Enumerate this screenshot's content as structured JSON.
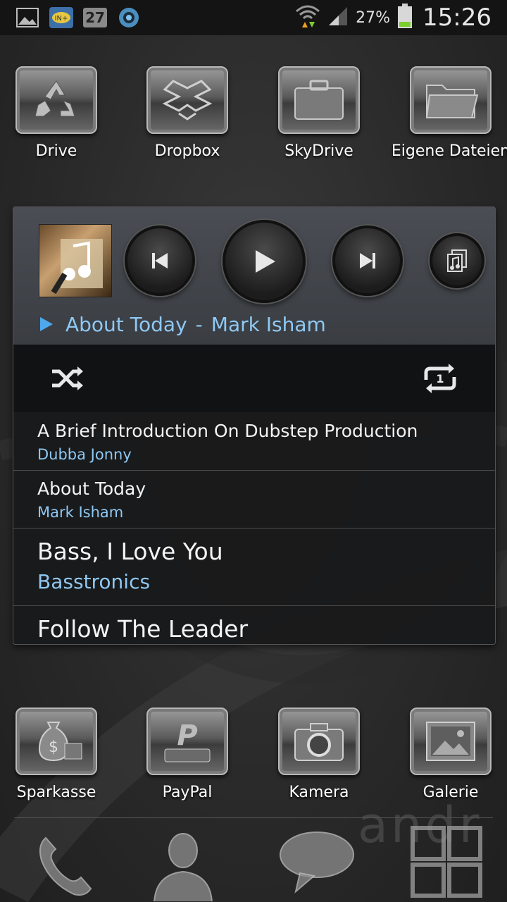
{
  "status_bar": {
    "calendar_day": "27",
    "battery_percent": "27%",
    "time": "15:26",
    "icons": [
      "picture-icon",
      "rss-feed-icon",
      "calendar-icon",
      "camera-eye-icon",
      "wifi-icon",
      "signal-icon",
      "battery-icon"
    ]
  },
  "apps_top": [
    {
      "label": "Drive",
      "icon": "recycle-icon"
    },
    {
      "label": "Dropbox",
      "icon": "dropbox-icon"
    },
    {
      "label": "SkyDrive",
      "icon": "briefcase-icon"
    },
    {
      "label": "Eigene Dateien",
      "icon": "folder-icon"
    }
  ],
  "music_widget": {
    "now_playing_title": "About Today",
    "now_playing_separator": "-",
    "now_playing_artist": "Mark Isham",
    "controls": [
      "previous-icon",
      "play-icon",
      "next-icon",
      "playlist-icon"
    ],
    "modes": [
      "shuffle-icon",
      "repeat-one-icon"
    ],
    "tracks": [
      {
        "title": "A Brief Introduction On Dubstep Production",
        "artist": "Dubba Jonny"
      },
      {
        "title": "About Today",
        "artist": "Mark Isham"
      },
      {
        "title": "Bass, I Love You",
        "artist": "Basstronics"
      },
      {
        "title": "Follow The Leader",
        "artist": ""
      }
    ]
  },
  "apps_bottom": [
    {
      "label": "Sparkasse",
      "icon": "money-bag-icon"
    },
    {
      "label": "PayPal",
      "icon": "paypal-icon"
    },
    {
      "label": "Kamera",
      "icon": "camera-icon"
    },
    {
      "label": "Galerie",
      "icon": "gallery-icon"
    }
  ],
  "dock": [
    "phone-icon",
    "contacts-icon",
    "messages-icon",
    "app-drawer-icon"
  ],
  "colors": {
    "accent_blue": "#8ec8f4",
    "statusbar_bg": "#141414",
    "battery_green": "#7ccd2e"
  }
}
